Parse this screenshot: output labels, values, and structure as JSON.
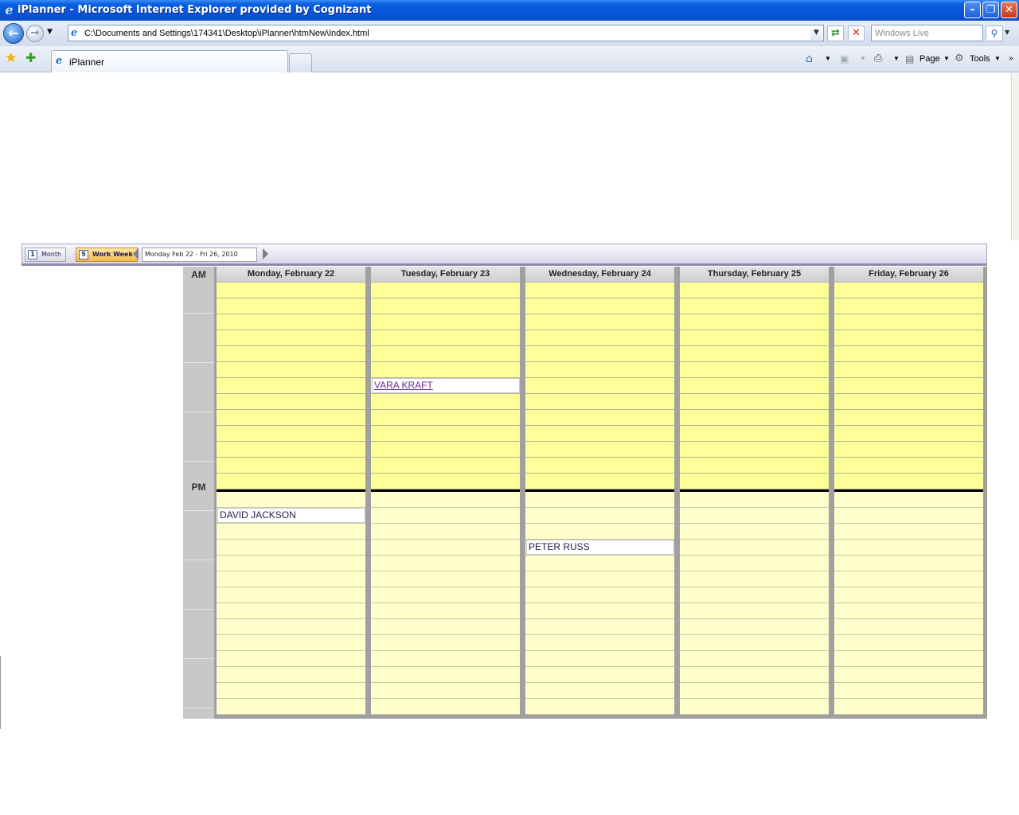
{
  "window": {
    "title": "iPlanner - Microsoft Internet Explorer provided by Cognizant",
    "minimize_glyph": "–",
    "maximize_glyph": "❐",
    "close_glyph": "✕"
  },
  "navigation": {
    "address": "C:\\Documents and Settings\\174341\\Desktop\\iPlanner\\htmNew\\Index.html",
    "search_placeholder": "Windows Live",
    "icons": [
      "back-icon",
      "forward-icon",
      "refresh-icon",
      "stop-icon",
      "search-icon"
    ]
  },
  "tabs": {
    "active_tab": "iPlanner"
  },
  "command_bar": {
    "page_label": "Page",
    "tools_label": "Tools",
    "icons": [
      "home-icon",
      "feeds-icon",
      "print-icon",
      "page-icon",
      "tools-icon"
    ]
  },
  "calendar_toolbar": {
    "month_label": "Month",
    "month_icon_text": "1",
    "work_week_label": "Work Week",
    "work_week_icon_text": "5",
    "date_range": "Monday Feb 22 - Fri 26, 2010"
  },
  "calendar": {
    "am_label": "AM",
    "pm_label": "PM",
    "colors": {
      "am_slot": "#ffff99",
      "pm_slot": "#ffffcc",
      "header": "#d8d8d8",
      "divider": "#a0a0a0"
    },
    "days": [
      {
        "header": "Monday, February 22"
      },
      {
        "header": "Tuesday, February 23"
      },
      {
        "header": "Wednesday, February 24"
      },
      {
        "header": "Thursday, February 25"
      },
      {
        "header": "Friday, February 26"
      }
    ],
    "appointments": [
      {
        "day": 1,
        "slot": 6,
        "title": "VARA KRAFT",
        "link": true
      },
      {
        "day": 0,
        "slot": 14,
        "title": "DAVID JACKSON",
        "link": false
      },
      {
        "day": 2,
        "slot": 16,
        "title": "PETER RUSS",
        "link": false
      }
    ]
  }
}
